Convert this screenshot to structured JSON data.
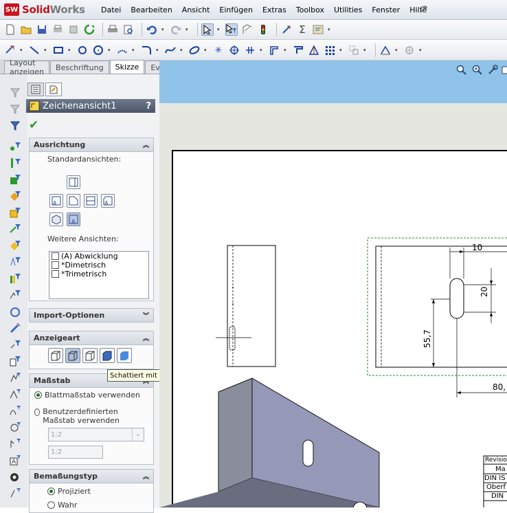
{
  "app": {
    "brand_prefix": "Solid",
    "brand_suffix": "Works",
    "logo_badge": "SW"
  },
  "menu": [
    "Datei",
    "Bearbeiten",
    "Ansicht",
    "Einfügen",
    "Extras",
    "Toolbox",
    "Utilities",
    "Fenster",
    "Hilfe"
  ],
  "command_tabs": [
    {
      "label": "Layout anzeigen",
      "active": false
    },
    {
      "label": "Beschriftung",
      "active": false
    },
    {
      "label": "Skizze",
      "active": true
    },
    {
      "label": "Evaluieren",
      "active": false
    }
  ],
  "property_manager": {
    "title": "Zeichenansicht1",
    "help": "?",
    "ok_icon": "checkmark-icon",
    "orientation": {
      "header": "Ausrichtung",
      "standard_views_label": "Standardansichten:",
      "more_views_label": "Weitere Ansichten:",
      "more_views": [
        "(A) Abwicklung",
        "*Dimetrisch",
        "*Trimetrisch"
      ]
    },
    "import_options": {
      "header": "Import-Optionen"
    },
    "display_style": {
      "header": "Anzeigeart",
      "tooltip": "Schattiert mit Kanten"
    },
    "scale": {
      "header": "Maßstab",
      "option_sheet": "Blattmaßstab verwenden",
      "option_custom": "Benutzerdefinierten Maßstab verwenden",
      "combo_value": "1:2",
      "field_value": "1:2"
    },
    "dim_type": {
      "header": "Bemaßungstyp",
      "option_projected": "Projiziert",
      "option_true": "Wahr"
    }
  },
  "drawing": {
    "dim_10": "10",
    "dim_20": "20",
    "dim_55_7": "55,7",
    "dim_80": "80,",
    "title_block": [
      "Revisio",
      "Ma",
      "DIN IS",
      "Oberf",
      "DIN"
    ]
  },
  "colors": {
    "viewport_bar": "#8fc3ea",
    "canvas_bg": "#e6e6e0",
    "brand_red": "#c0141c"
  }
}
